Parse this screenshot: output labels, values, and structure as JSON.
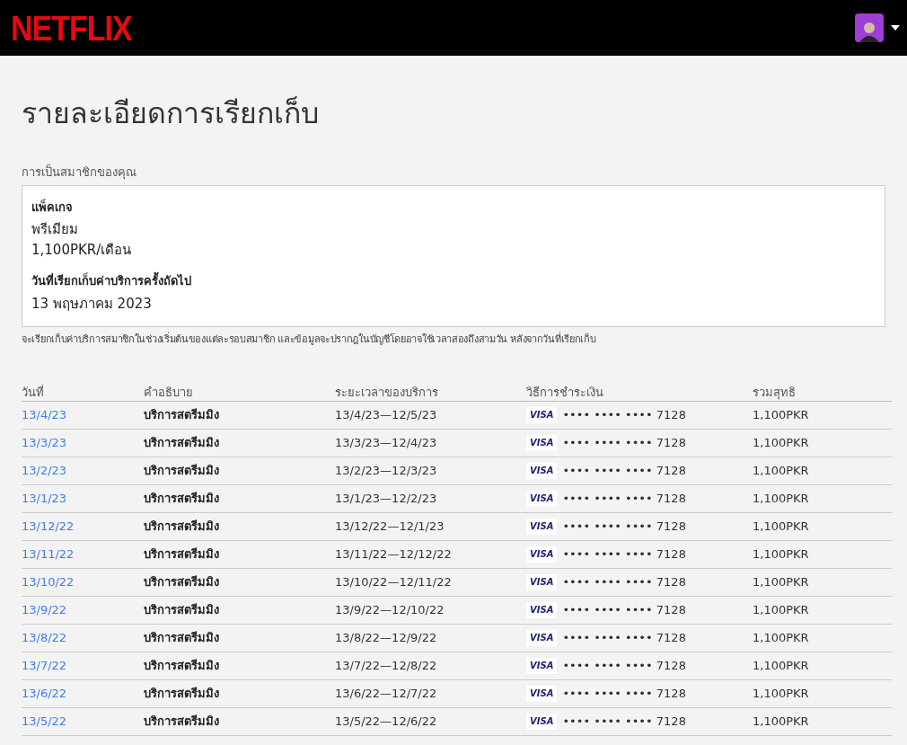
{
  "header": {
    "logo": "NETFLIX"
  },
  "page_title": "รายละเอียดการเรียกเก็บ",
  "membership": {
    "heading": "การเป็นสมาชิกของคุณ",
    "plan_label": "แพ็คเกจ",
    "plan_name": "พรีเมียม",
    "plan_price": "1,100PKR/เดือน",
    "next_billing_label": "วันที่เรียกเก็บค่าบริการครั้งถัดไป",
    "next_billing_date": "13 พฤษภาคม 2023",
    "note": "จะเรียกเก็บค่าบริการสมาชิกในช่วงเริ่มต้นของแต่ละรอบสมาชิก และข้อมูลจะปรากฎในบัญชีโดยอาจใช้เวลาสองถึงสามวัน หลังจากวันที่เรียกเก็บ"
  },
  "table": {
    "columns": [
      "วันที่",
      "คำอธิบาย",
      "ระยะเวลาของบริการ",
      "วิธีการชำระเงิน",
      "รวมสุทธิ"
    ],
    "rows": [
      {
        "date": "13/4/23",
        "description": "บริการสตรีมมิง",
        "period": "13/4/23—12/5/23",
        "card_brand": "VISA",
        "card_number": "•••• •••• •••• 7128",
        "total": "1,100PKR"
      },
      {
        "date": "13/3/23",
        "description": "บริการสตรีมมิง",
        "period": "13/3/23—12/4/23",
        "card_brand": "VISA",
        "card_number": "•••• •••• •••• 7128",
        "total": "1,100PKR"
      },
      {
        "date": "13/2/23",
        "description": "บริการสตรีมมิง",
        "period": "13/2/23—12/3/23",
        "card_brand": "VISA",
        "card_number": "•••• •••• •••• 7128",
        "total": "1,100PKR"
      },
      {
        "date": "13/1/23",
        "description": "บริการสตรีมมิง",
        "period": "13/1/23—12/2/23",
        "card_brand": "VISA",
        "card_number": "•••• •••• •••• 7128",
        "total": "1,100PKR"
      },
      {
        "date": "13/12/22",
        "description": "บริการสตรีมมิง",
        "period": "13/12/22—12/1/23",
        "card_brand": "VISA",
        "card_number": "•••• •••• •••• 7128",
        "total": "1,100PKR"
      },
      {
        "date": "13/11/22",
        "description": "บริการสตรีมมิง",
        "period": "13/11/22—12/12/22",
        "card_brand": "VISA",
        "card_number": "•••• •••• •••• 7128",
        "total": "1,100PKR"
      },
      {
        "date": "13/10/22",
        "description": "บริการสตรีมมิง",
        "period": "13/10/22—12/11/22",
        "card_brand": "VISA",
        "card_number": "•••• •••• •••• 7128",
        "total": "1,100PKR"
      },
      {
        "date": "13/9/22",
        "description": "บริการสตรีมมิง",
        "period": "13/9/22—12/10/22",
        "card_brand": "VISA",
        "card_number": "•••• •••• •••• 7128",
        "total": "1,100PKR"
      },
      {
        "date": "13/8/22",
        "description": "บริการสตรีมมิง",
        "period": "13/8/22—12/9/22",
        "card_brand": "VISA",
        "card_number": "•••• •••• •••• 7128",
        "total": "1,100PKR"
      },
      {
        "date": "13/7/22",
        "description": "บริการสตรีมมิง",
        "period": "13/7/22—12/8/22",
        "card_brand": "VISA",
        "card_number": "•••• •••• •••• 7128",
        "total": "1,100PKR"
      },
      {
        "date": "13/6/22",
        "description": "บริการสตรีมมิง",
        "period": "13/6/22—12/7/22",
        "card_brand": "VISA",
        "card_number": "•••• •••• •••• 7128",
        "total": "1,100PKR"
      },
      {
        "date": "13/5/22",
        "description": "บริการสตรีมมิง",
        "period": "13/5/22—12/6/22",
        "card_brand": "VISA",
        "card_number": "•••• •••• •••• 7128",
        "total": "1,100PKR"
      }
    ]
  }
}
